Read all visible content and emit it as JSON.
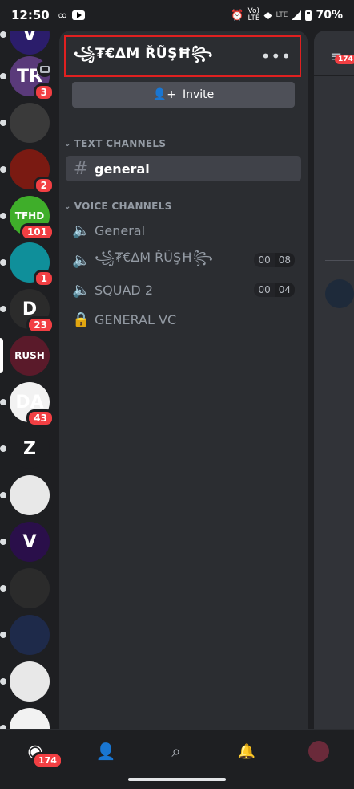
{
  "status_bar": {
    "time": "12:50",
    "battery": "70%",
    "network": "LTE"
  },
  "servers": [
    {
      "name": "server-1",
      "color": "#2b1d6b",
      "glyph": "V",
      "badge": null
    },
    {
      "name": "server-2",
      "color": "#5a3a7a",
      "glyph": "TR",
      "badge": "3"
    },
    {
      "name": "server-3",
      "color": "#3a3a3a",
      "glyph": "",
      "badge": null
    },
    {
      "name": "server-4",
      "color": "#7a1a12",
      "glyph": "",
      "badge": "2"
    },
    {
      "name": "server-5",
      "color": "#3fae2a",
      "glyph": "TFHD",
      "badge": "101"
    },
    {
      "name": "server-6",
      "color": "#0f8f9a",
      "glyph": "",
      "badge": "1"
    },
    {
      "name": "server-7",
      "color": "#2b2b2b",
      "glyph": "D",
      "badge": "23"
    },
    {
      "name": "server-8",
      "color": "#5a1a2a",
      "glyph": "RUSH",
      "badge": null,
      "active": true
    },
    {
      "name": "server-9",
      "color": "#f2f2f2",
      "glyph": "DA",
      "badge": "43"
    },
    {
      "name": "server-10",
      "color": "#1e1f22",
      "glyph": "Z",
      "badge": null
    },
    {
      "name": "server-11",
      "color": "#e8e8e8",
      "glyph": "",
      "badge": null
    },
    {
      "name": "server-12",
      "color": "#2a0f4a",
      "glyph": "V",
      "badge": null
    },
    {
      "name": "server-13",
      "color": "#2b2b2b",
      "glyph": "",
      "badge": null
    },
    {
      "name": "server-14",
      "color": "#1e2a4a",
      "glyph": "",
      "badge": null
    },
    {
      "name": "server-15",
      "color": "#e8e8e8",
      "glyph": "",
      "badge": null
    },
    {
      "name": "server-16",
      "color": "#f2f2f2",
      "glyph": "",
      "badge": null
    }
  ],
  "server_header": {
    "name": "꧁₮€ΔM ŘŨŞĦ꧂",
    "more_icon": "more-horizontal-icon"
  },
  "invite": {
    "label": "Invite"
  },
  "categories": {
    "text": "TEXT CHANNELS",
    "voice": "VOICE CHANNELS"
  },
  "text_channels": [
    {
      "label": "general",
      "selected": true
    }
  ],
  "voice_channels": [
    {
      "label": "General",
      "icon": "speaker-icon",
      "count_a": "",
      "count_b": ""
    },
    {
      "label": "꧁₮€ΔM ŘŨŞĦ꧂",
      "icon": "speaker-icon",
      "count_a": "00",
      "count_b": "08"
    },
    {
      "label": "SQUAD 2",
      "icon": "speaker-icon",
      "count_a": "00",
      "count_b": "04"
    },
    {
      "label": "GENERAL VC",
      "icon": "lock-icon",
      "count_a": "",
      "count_b": ""
    }
  ],
  "right_pane": {
    "filter_badge": "174"
  },
  "bottom_nav": {
    "home_badge": "174"
  },
  "colors": {
    "rail": "#1e1f22",
    "panel": "#2b2d31",
    "selected": "#404249",
    "danger": "#f23f43",
    "header_border": "#e02020"
  }
}
